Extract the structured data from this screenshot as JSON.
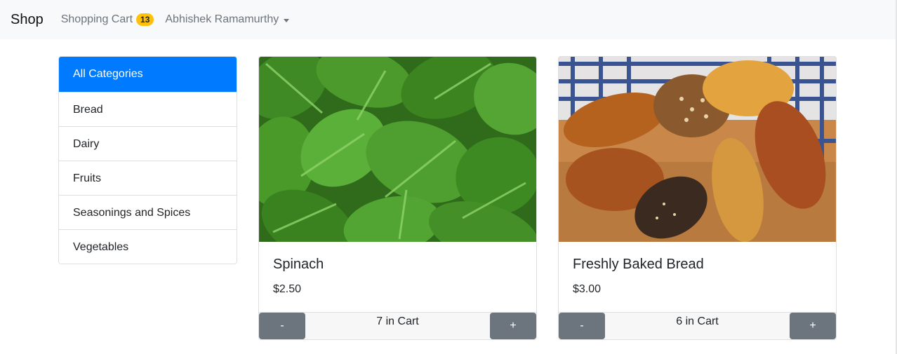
{
  "navbar": {
    "brand": "Shop",
    "cart_label": "Shopping Cart",
    "cart_count": "13",
    "user_name": "Abhishek Ramamurthy"
  },
  "categories": [
    {
      "label": "All Categories",
      "active": true
    },
    {
      "label": "Bread",
      "active": false
    },
    {
      "label": "Dairy",
      "active": false
    },
    {
      "label": "Fruits",
      "active": false
    },
    {
      "label": "Seasonings and Spices",
      "active": false
    },
    {
      "label": "Vegetables",
      "active": false
    }
  ],
  "products": [
    {
      "title": "Spinach",
      "price": "$2.50",
      "cart_text": "7 in Cart",
      "minus": "-",
      "plus": "+",
      "image": "spinach-leaves"
    },
    {
      "title": "Freshly Baked Bread",
      "price": "$3.00",
      "cart_text": "6 in Cart",
      "minus": "-",
      "plus": "+",
      "image": "bread-rolls"
    }
  ],
  "colors": {
    "primary": "#007bff",
    "secondary": "#6c757d",
    "badge": "#ffc107",
    "navbar_bg": "#f8f9fa"
  }
}
